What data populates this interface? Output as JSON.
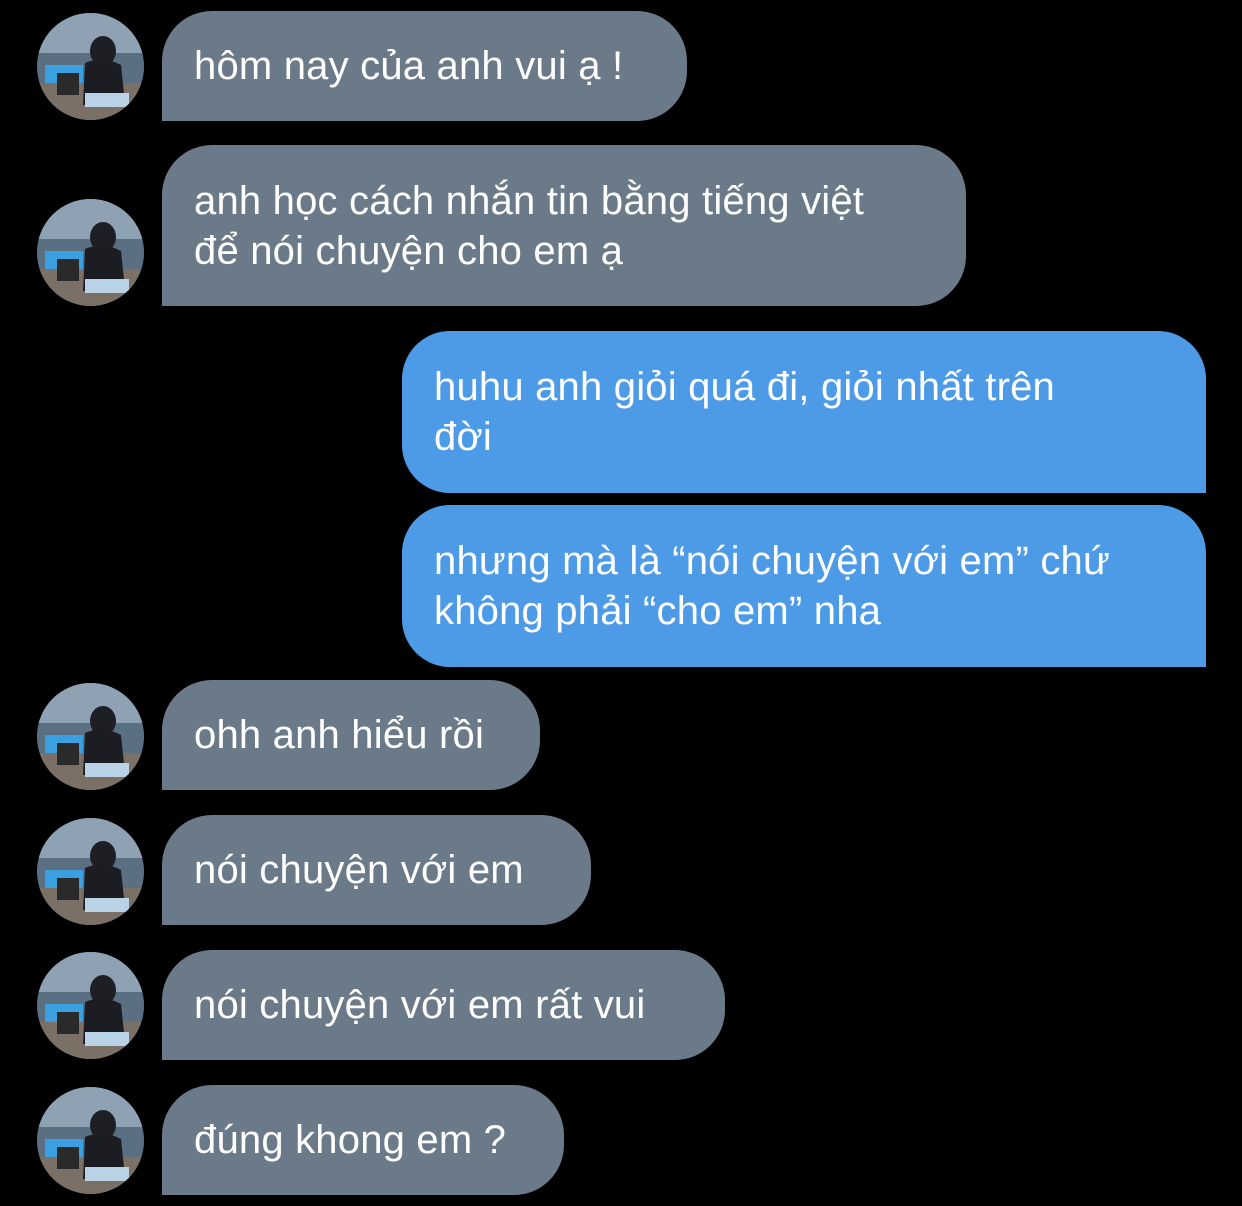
{
  "conversation": {
    "messages": [
      {
        "sender": "other",
        "text": "hôm nay của anh vui ạ !",
        "show_avatar": true
      },
      {
        "sender": "other",
        "text": "anh học cách nhắn tin bằng tiếng việt\nđể nói chuyện cho em ạ",
        "show_avatar": true
      },
      {
        "sender": "me",
        "text": "huhu anh giỏi quá đi, giỏi nhất trên\nđời"
      },
      {
        "sender": "me",
        "text": "nhưng mà là “nói chuyện với em” chứ\nkhông phải “cho em” nha"
      },
      {
        "sender": "other",
        "text": "ohh anh hiểu rồi",
        "show_avatar": true
      },
      {
        "sender": "other",
        "text": "nói chuyện với em",
        "show_avatar": true
      },
      {
        "sender": "other",
        "text": "nói chuyện với em rất vui",
        "show_avatar": true
      },
      {
        "sender": "other",
        "text": "đúng khong em ?",
        "show_avatar": true
      }
    ]
  },
  "colors": {
    "background": "#000000",
    "incoming_bubble": "#6b7a88",
    "outgoing_bubble": "#4d9be6",
    "text": "#ffffff"
  },
  "icons": {
    "avatar": "contact-photo-avatar-icon"
  }
}
